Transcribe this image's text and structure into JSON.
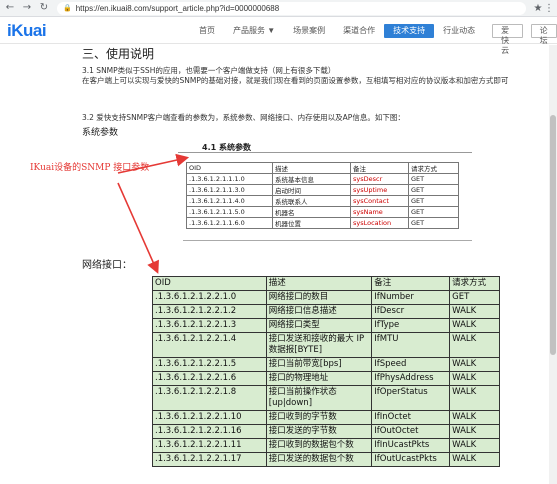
{
  "browser": {
    "back": "←",
    "forward": "→",
    "reload": "↻",
    "url": "https://en.ikuai8.com/support_article.php?id=0000000688",
    "star": "★",
    "menu": "⋮"
  },
  "site": {
    "logo": "iKuai",
    "nav": [
      "首页",
      "产品服务 ▼",
      "场景案例",
      "渠道合作",
      "技术支持",
      "行业动态"
    ],
    "active_index": 4,
    "buttons": [
      "爱快云",
      "论坛"
    ]
  },
  "article": {
    "section_title": "三、使用说明",
    "p1": "3.1 SNMP类似于SSH的应用，也需要一个客户端做支持（网上有很多下载）",
    "p2": "在客户端上可以实现与爱快的SNMP的基础对接，就是我们现在看到的页面设置参数，互相填写相对应的协议版本和加密方式即可",
    "p3": "3.2 爱快支持SNMP客户端查看的参数为，系统参数、网络接口、内存使用以及AP信息。如下图：",
    "sys_label": "系统参数",
    "net_label": "网络接口：",
    "annotation": "IKuai设备的SNMP 接口参数"
  },
  "doc_image": {
    "title": "4.1  系统参数",
    "headers": [
      "OID",
      "描述",
      "备注",
      "请求方式"
    ],
    "rows": [
      [
        ".1.3.6.1.2.1.1.1.0",
        "系统基本信息",
        "sysDescr",
        "GET"
      ],
      [
        ".1.3.6.1.2.1.1.3.0",
        "启动时间",
        "sysUptime",
        "GET"
      ],
      [
        ".1.3.6.1.2.1.1.4.0",
        "系统联系人",
        "sysContact",
        "GET"
      ],
      [
        ".1.3.6.1.2.1.1.5.0",
        "机器名",
        "sysName",
        "GET"
      ],
      [
        ".1.3.6.1.2.1.1.6.0",
        "机器位置",
        "sysLocation",
        "GET"
      ]
    ]
  },
  "net_table": {
    "headers": [
      "OID",
      "描述",
      "备注",
      "请求方式"
    ],
    "rows": [
      [
        ".1.3.6.1.2.1.2.2.1.0",
        "网络接口的数目",
        "IfNumber",
        "GET"
      ],
      [
        ".1.3.6.1.2.1.2.2.1.2",
        "网络接口信息描述",
        "IfDescr",
        "WALK"
      ],
      [
        ".1.3.6.1.2.1.2.2.1.3",
        "网络接口类型",
        "IfType",
        "WALK"
      ],
      [
        ".1.3.6.1.2.1.2.2.1.4",
        "接口发送和接收的最大 IP 数据报[BYTE]",
        "IfMTU",
        "WALK"
      ],
      [
        ".1.3.6.1.2.1.2.2.1.5",
        "接口当前带宽[bps]",
        "IfSpeed",
        "WALK"
      ],
      [
        ".1.3.6.1.2.1.2.2.1.6",
        "接口的物理地址",
        "IfPhysAddress",
        "WALK"
      ],
      [
        ".1.3.6.1.2.1.2.2.1.8",
        "接口当前操作状态[up|down]",
        "IfOperStatus",
        "WALK"
      ],
      [
        ".1.3.6.1.2.1.2.2.1.10",
        "接口收到的字节数",
        "IfInOctet",
        "WALK"
      ],
      [
        ".1.3.6.1.2.1.2.2.1.16",
        "接口发送的字节数",
        "IfOutOctet",
        "WALK"
      ],
      [
        ".1.3.6.1.2.1.2.2.1.11",
        "接口收到的数据包个数",
        "IfInUcastPkts",
        "WALK"
      ],
      [
        ".1.3.6.1.2.1.2.2.1.17",
        "接口发送的数据包个数",
        "IfOutUcastPkts",
        "WALK"
      ]
    ]
  }
}
